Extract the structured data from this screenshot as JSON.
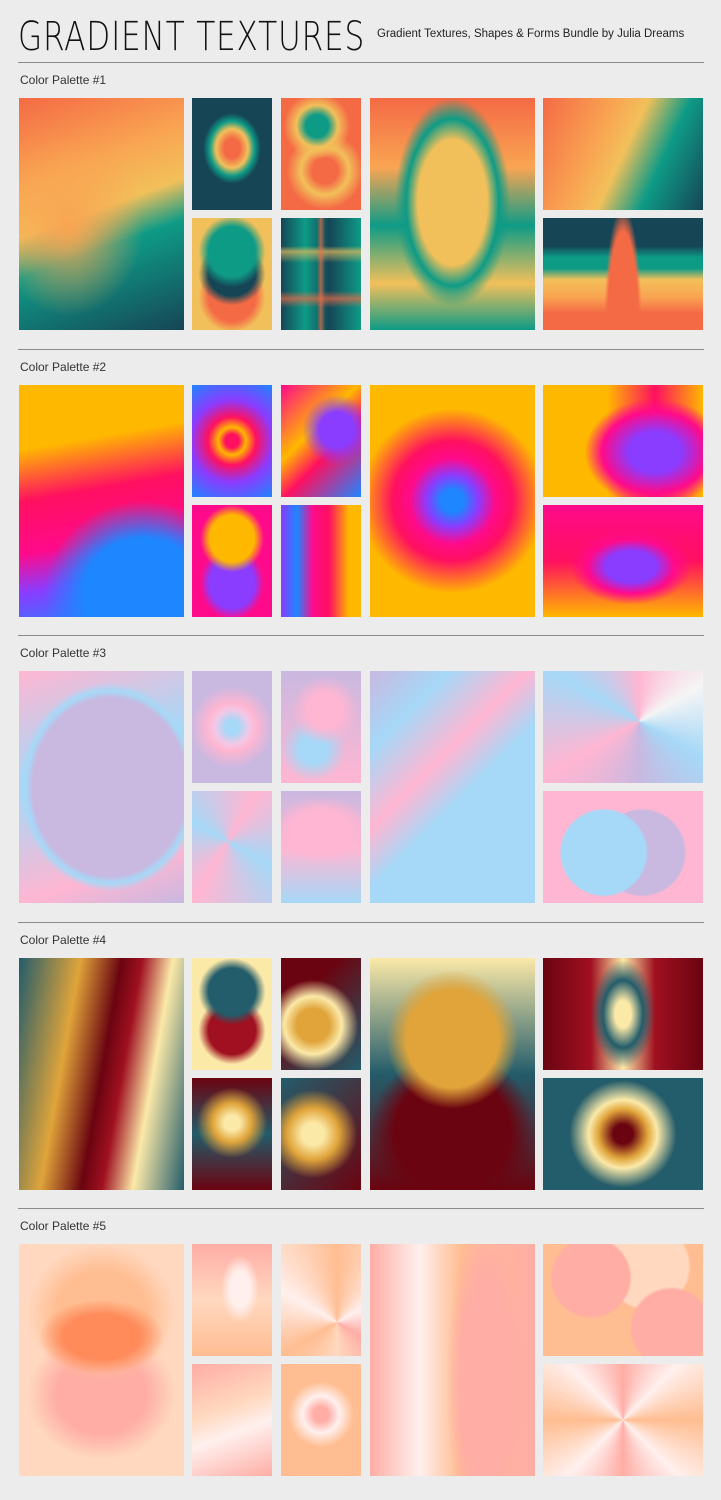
{
  "header": {
    "title": "GRADIENT TEXTURES",
    "subtitle": "Gradient Textures, Shapes & Forms Bundle by Julia Dreams"
  },
  "sections": [
    {
      "label": "Color Palette #1",
      "colors": [
        "#f46a45",
        "#f9a552",
        "#f2c05a",
        "#0e9b86",
        "#164556"
      ]
    },
    {
      "label": "Color Palette #2",
      "colors": [
        "#ffb800",
        "#ff1060",
        "#ff0a8a",
        "#8a3cff",
        "#1e86ff"
      ]
    },
    {
      "label": "Color Palette #3",
      "colors": [
        "#ffb6d2",
        "#c9b8e0",
        "#a6d8f7",
        "#88b4f0",
        "#f2c8e6"
      ]
    },
    {
      "label": "Color Palette #4",
      "colors": [
        "#fbe9a8",
        "#e0a43a",
        "#a01020",
        "#6a0410",
        "#235c6a"
      ]
    },
    {
      "label": "Color Palette #5",
      "colors": [
        "#ffd8bf",
        "#ffbd91",
        "#ff8a5a",
        "#ffada5",
        "#fff0ee"
      ]
    }
  ]
}
